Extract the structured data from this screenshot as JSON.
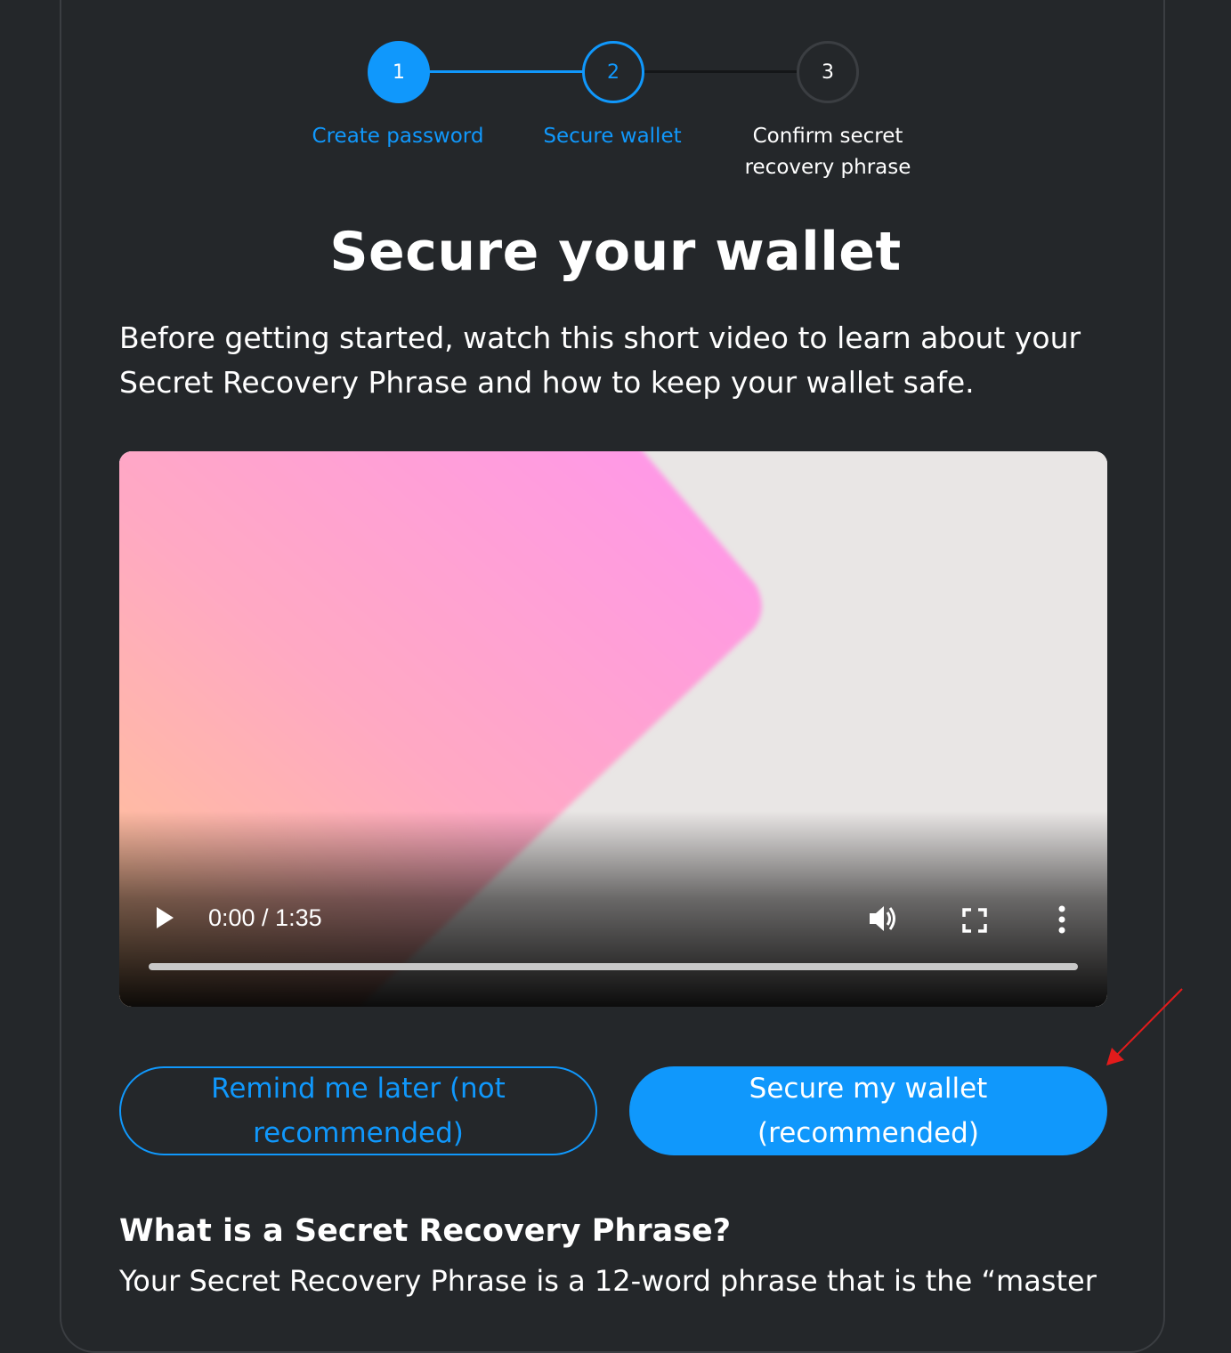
{
  "colors": {
    "background": "#24272a",
    "accent": "#1098fc",
    "inactive": "#3b3e42",
    "annotation": "#e31b1b"
  },
  "stepper": {
    "steps": [
      {
        "number": "1",
        "label": "Create password",
        "state": "complete"
      },
      {
        "number": "2",
        "label": "Secure wallet",
        "state": "current"
      },
      {
        "number": "3",
        "label_line1": "Confirm secret",
        "label_line2": "recovery phrase",
        "state": "upcoming"
      }
    ]
  },
  "main": {
    "title": "Secure your wallet",
    "intro": "Before getting started, watch this short video to learn about your Secret Recovery Phrase and how to keep your wallet safe."
  },
  "video": {
    "time_display": "0:00 / 1:35",
    "progress_fraction": 0.0,
    "icons": [
      "play-icon",
      "volume-icon",
      "fullscreen-icon",
      "more-options-icon"
    ]
  },
  "actions": {
    "remind_later": "Remind me later (not recommended)",
    "secure_wallet": "Secure my wallet (recommended)"
  },
  "faq": {
    "title": "What is a Secret Recovery Phrase?",
    "body": "Your Secret Recovery Phrase is a 12-word phrase that is the “master"
  }
}
